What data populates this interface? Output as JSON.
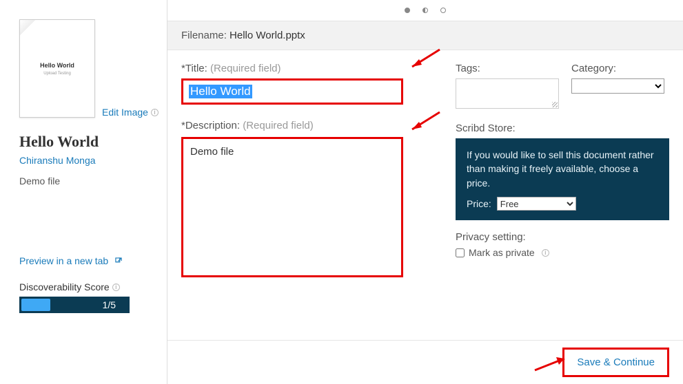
{
  "sidebar": {
    "thumb_title": "Hello World",
    "thumb_sub": "Upload Testing",
    "edit_image": "Edit Image",
    "doc_title": "Hello World",
    "author": "Chiranshu Monga",
    "doc_desc": "Demo file",
    "preview_label": "Preview in a new tab",
    "disc_label": "Discoverability Score",
    "disc_value": "1/5"
  },
  "header": {
    "filename_label": "Filename:",
    "filename": "Hello World.pptx"
  },
  "form": {
    "title_label": "*Title:",
    "title_hint": "(Required field)",
    "title_value": "Hello World",
    "desc_label": "*Description:",
    "desc_hint": "(Required field)",
    "desc_value": "Demo file",
    "tags_label": "Tags:",
    "category_label": "Category:",
    "category_value": "",
    "store_label": "Scribd Store:",
    "store_text": "If you would like to sell this document rather than making it freely available, choose a price.",
    "price_label": "Price:",
    "price_value": "Free",
    "privacy_label": "Privacy setting:",
    "privacy_checkbox": "Mark as private"
  },
  "footer": {
    "save_label": "Save & Continue"
  }
}
